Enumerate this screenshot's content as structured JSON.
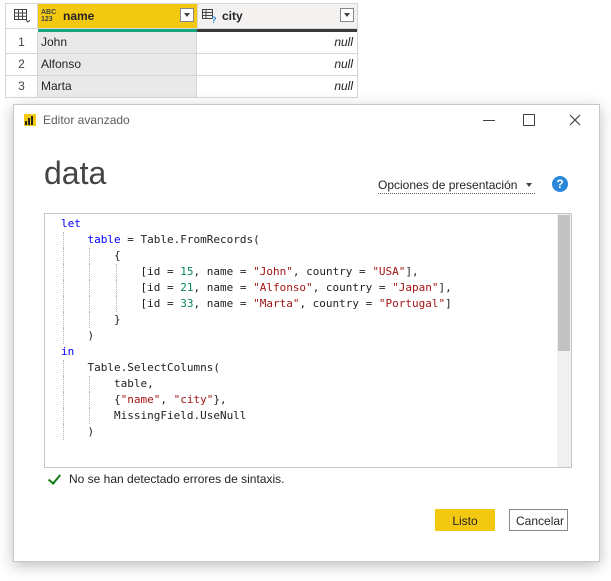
{
  "grid": {
    "columns": [
      {
        "name": "name",
        "type_icon": "ABC\n123"
      },
      {
        "name": "city",
        "type_icon": "table-question-icon"
      }
    ],
    "rows": [
      {
        "index": "1",
        "name": "John",
        "city": "null"
      },
      {
        "index": "2",
        "name": "Alfonso",
        "city": "null"
      },
      {
        "index": "3",
        "name": "Marta",
        "city": "null"
      }
    ],
    "colors": {
      "selected_column": "#f2c811",
      "quality_valid": "#15a47f",
      "quality_empty": "#3b3a39"
    }
  },
  "dialog": {
    "title": "Editor avanzado",
    "query_name": "data",
    "display_options_label": "Opciones de presentación",
    "status_text": "No se han detectado errores de sintaxis.",
    "done_label": "Listo",
    "cancel_label": "Cancelar",
    "accent_color": "#f2c811"
  },
  "code_lines": [
    "let",
    "    table = Table.FromRecords(",
    "        {",
    "            [id = 15, name = \"John\", country = \"USA\"],",
    "            [id = 21, name = \"Alfonso\", country = \"Japan\"],",
    "            [id = 33, name = \"Marta\", country = \"Portugal\"]",
    "        }",
    "    )",
    "in",
    "    Table.SelectColumns(",
    "        table,",
    "        {\"name\", \"city\"},",
    "        MissingField.UseNull",
    "    )"
  ]
}
